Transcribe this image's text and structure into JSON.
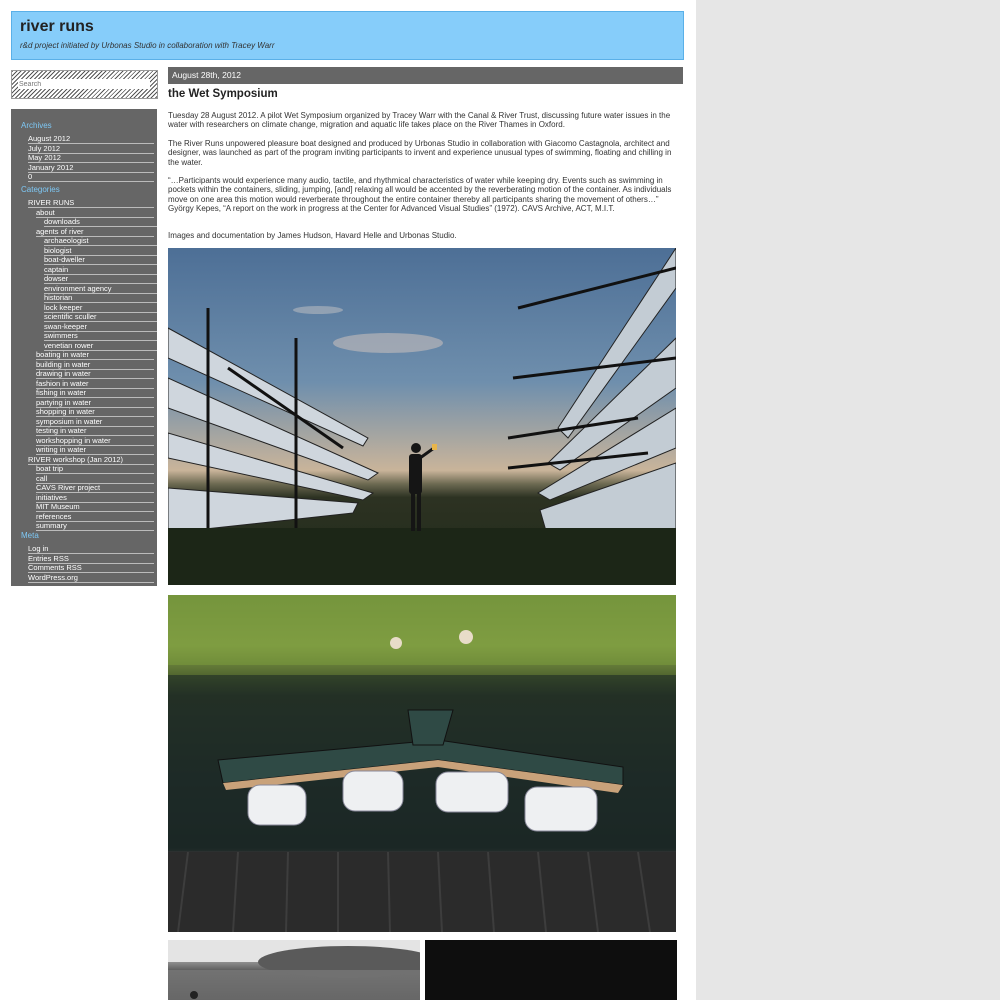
{
  "site": {
    "title": "river runs",
    "description": "r&d project initiated by Urbonas Studio in collaboration with Tracey Warr"
  },
  "search": {
    "placeholder": "Search"
  },
  "sidebar": {
    "archives_heading": "Archives",
    "archives": [
      "August 2012",
      "July 2012",
      "May 2012",
      "January 2012",
      "0"
    ],
    "categories_heading": "Categories",
    "categories": {
      "river_runs": "RIVER RUNS",
      "about": "about",
      "downloads": "downloads",
      "agents": "agents of river",
      "agent_items": [
        "archaeologist",
        "biologist",
        "boat-dweller",
        "captain",
        "dowser",
        "environment agency",
        "historian",
        "lock keeper",
        "scientific sculler",
        "swan-keeper",
        "swimmers",
        "venetian rower"
      ],
      "activities": [
        "boating in water",
        "building in water",
        "drawing in water",
        "fashion in water",
        "fishing in water",
        "partying in water",
        "shopping in water",
        "symposium in water",
        "testing in water",
        "workshopping in water",
        "writing in water"
      ],
      "workshop": "RIVER workshop (Jan 2012)",
      "workshop_items": [
        "boat trip",
        "call",
        "CAVS River project",
        "initiatives",
        "MIT Museum",
        "references",
        "summary"
      ]
    },
    "meta_heading": "Meta",
    "meta": [
      "Log in",
      "Entries RSS",
      "Comments RSS",
      "WordPress.org"
    ]
  },
  "post": {
    "date": "August 28th, 2012",
    "title": "the Wet Symposium",
    "paragraphs": [
      "Tuesday 28 August 2012. A pilot Wet Symposium organized by Tracey Warr with the Canal & River Trust, discussing future water issues in the water with researchers on climate change, migration and aquatic life takes place on the River Thames in Oxford.",
      "The River Runs unpowered pleasure boat designed and produced by Urbonas Studio in collaboration with Giacomo Castagnola, architect and designer, was launched as part of the program inviting participants to invent and experience unusual types of swimming, floating and chilling in the water.",
      "“…Participants would experience many audio, tactile, and rhythmical characteristics of water while keeping dry. Events such as swimming in pockets within the containers, sliding, jumping, [and] relaxing all would be accented by the reverberating motion of the container. As individuals move on one area this motion would reverberate throughout the entire container thereby all participants sharing the movement of others…” György Kepes,  “A report on the work in progress at the Center for Advanced Visual Studies” (1972). CAVS Archive, ACT, M.I.T.",
      "Images and documentation by James Hudson, Havard Helle and Urbonas Studio."
    ]
  },
  "colors": {
    "header_bg": "#86cdfa",
    "sidebar_bg": "#666666",
    "heading_blue": "#7ec8f5"
  }
}
